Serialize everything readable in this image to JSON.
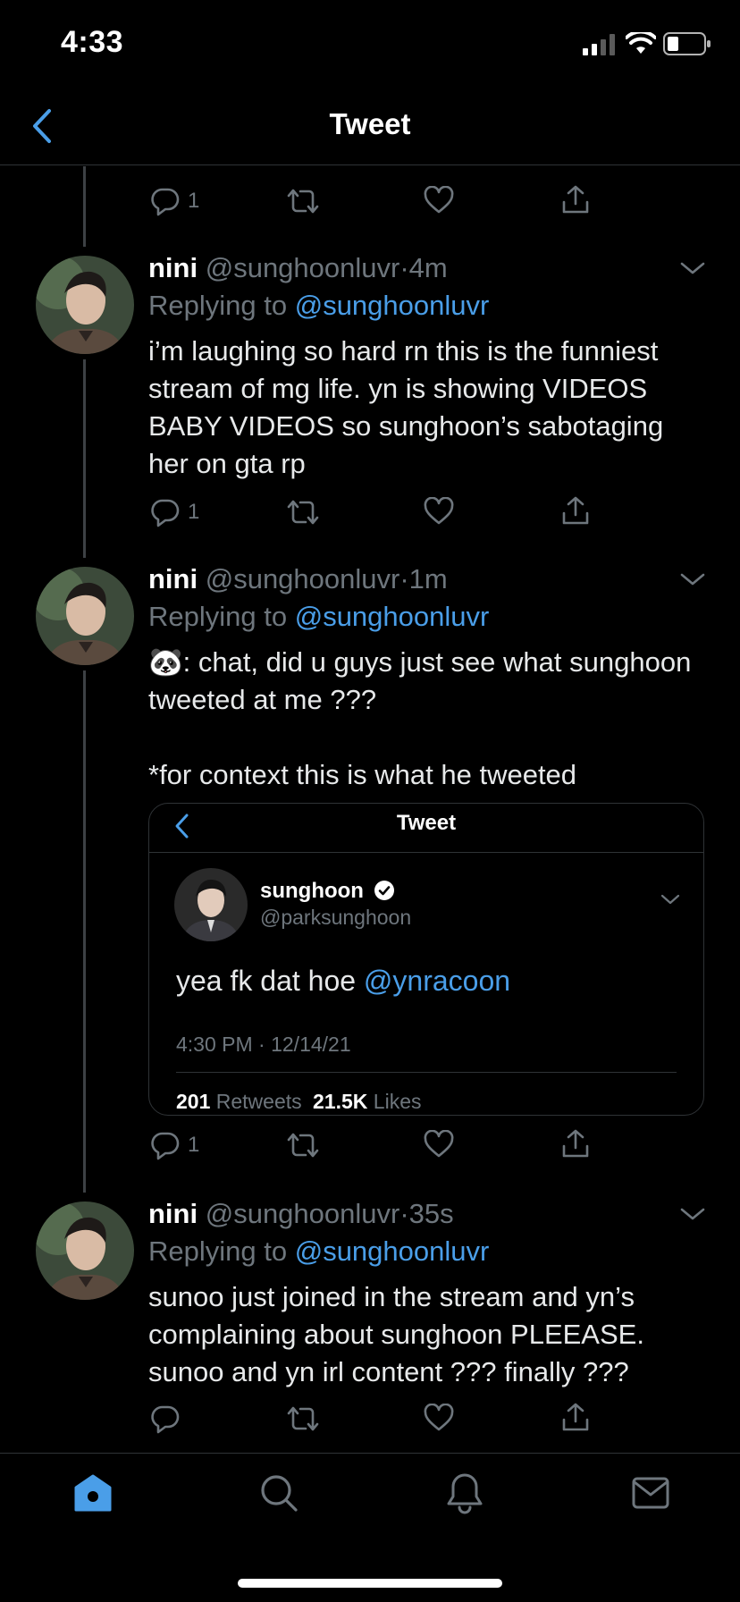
{
  "status_bar": {
    "time": "4:33"
  },
  "nav": {
    "title": "Tweet"
  },
  "top_actions": {
    "reply_count": "1"
  },
  "tweets": [
    {
      "name": "nini",
      "handle": "@sunghoonluvr",
      "sep": "·",
      "time": "4m",
      "replying_prefix": "Replying to",
      "replying_handle": "@sunghoonluvr",
      "text": "i’m laughing so hard rn this is the funniest stream of mg life. yn is showing VIDEOS BABY VIDEOS so sunghoon’s sabotaging her on gta rp",
      "reply_count": "1"
    },
    {
      "name": "nini",
      "handle": "@sunghoonluvr",
      "sep": "·",
      "time": "1m",
      "replying_prefix": "Replying to",
      "replying_handle": "@sunghoonluvr",
      "text_line1": ": chat, did u guys just see what sunghoon tweeted at me ???",
      "emoji": "🐼",
      "text_line2": "*for context this is what he tweeted",
      "reply_count": "1"
    },
    {
      "name": "nini",
      "handle": "@sunghoonluvr",
      "sep": "·",
      "time": "35s",
      "replying_prefix": "Replying to",
      "replying_handle": "@sunghoonluvr",
      "text": "sunoo just joined in the stream and yn’s complaining about sunghoon PLEEASE. sunoo and yn irl content ??? finally ???"
    }
  ],
  "embedded": {
    "title": "Tweet",
    "name": "sunghoon",
    "handle": "@parksunghoon",
    "text": "yea fk dat hoe",
    "mention": "@ynracoon",
    "timestamp": "4:30 PM · 12/14/21",
    "retweets_count": "201",
    "retweets_label": "Retweets",
    "likes_count": "21.5K",
    "likes_label": "Likes"
  },
  "tabbar": [
    "home-icon",
    "search-icon",
    "notifications-icon",
    "messages-icon"
  ],
  "colors": {
    "accent": "#4a9ee8",
    "muted": "#6e767d",
    "background": "#000000"
  }
}
